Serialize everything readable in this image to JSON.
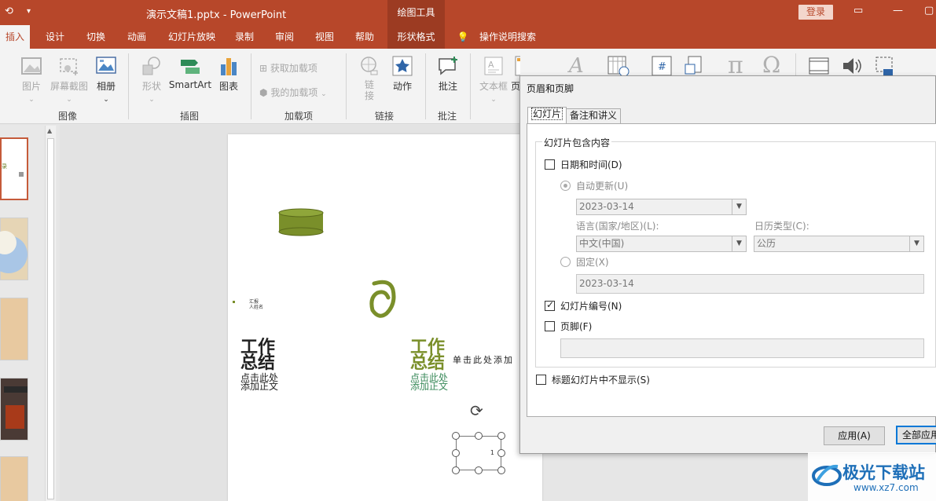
{
  "titlebar": {
    "document": "演示文稿1.pptx  -  PowerPoint",
    "context_group": "绘图工具",
    "login": "登录",
    "qat_icons": [
      "autosave-icon",
      "customize-qat-icon"
    ]
  },
  "tabs": [
    "插入",
    "设计",
    "切换",
    "动画",
    "幻灯片放映",
    "录制",
    "审阅",
    "视图",
    "帮助",
    "形状格式"
  ],
  "tell_me": "操作说明搜索",
  "ribbon": {
    "groups": {
      "images": "图像",
      "illustrations": "插图",
      "addins": "加载项",
      "links": "链接",
      "comments": "批注"
    },
    "buttons": {
      "pictures": "图片",
      "screenshot": "屏幕截图",
      "album": "相册",
      "shapes": "形状",
      "smartart": "SmartArt",
      "chart": "图表",
      "get_addins": "获取加载项",
      "my_addins": "我的加载项",
      "link": "链接",
      "action": "动作",
      "comment": "批注",
      "textbox": "文本框",
      "header_partial": "页"
    }
  },
  "slide": {
    "title_dark_line1": "工作",
    "title_dark_line2": "总结",
    "title_green_line1": "工作",
    "title_green_line2": "总结",
    "sub_dark": "点击此处添加正文",
    "sub_green": "点击此处添加正文",
    "handwritten": "单击此处添加",
    "tiny_text": "汇报 人姓名",
    "slide_number": "1"
  },
  "dialog": {
    "title": "页眉和页脚",
    "tabs": [
      "幻灯片",
      "备注和讲义"
    ],
    "group_title": "幻灯片包含内容",
    "date_time": "日期和时间(D)",
    "auto_update": "自动更新(U)",
    "auto_date": "2023-03-14",
    "language_label": "语言(国家/地区)(L):",
    "language_value": "中文(中国)",
    "calendar_label": "日历类型(C):",
    "calendar_value": "公历",
    "fixed": "固定(X)",
    "fixed_date": "2023-03-14",
    "slide_number": "幻灯片编号(N)",
    "footer": "页脚(F)",
    "footer_value": "",
    "hide_on_title": "标题幻灯片中不显示(S)",
    "apply": "应用(A)",
    "apply_all": "全部应用"
  },
  "watermark": {
    "name": "极光下载站",
    "url": "www.xz7.com"
  },
  "colors": {
    "brand": "#b7472a",
    "brand_dark": "#9c3b22",
    "olive": "#7a8f2a",
    "accent_blue": "#0078d7"
  }
}
